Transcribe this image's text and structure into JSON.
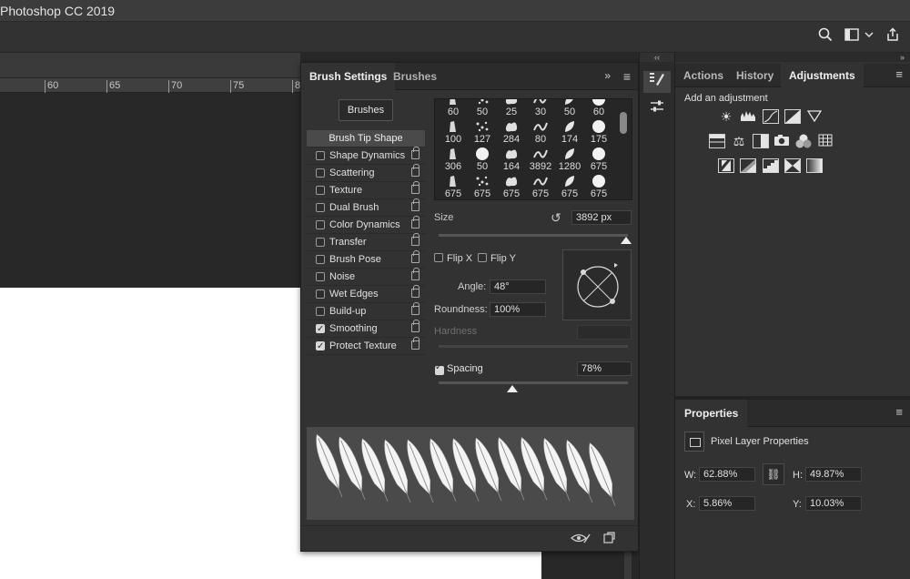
{
  "app": {
    "title": "Photoshop CC 2019"
  },
  "optionsbar": {
    "icons": [
      "search-icon",
      "workspace-icon",
      "share-icon"
    ]
  },
  "ruler": {
    "ticks": [
      "60",
      "65",
      "70",
      "75",
      "8"
    ]
  },
  "brush_panel": {
    "tabs": [
      "Brush Settings",
      "Brushes"
    ],
    "collapse_glyph": "»",
    "brushes_button": "Brushes",
    "options": [
      {
        "label": "Brush Tip Shape",
        "header": true
      },
      {
        "label": "Shape Dynamics",
        "checked": false
      },
      {
        "label": "Scattering",
        "checked": false
      },
      {
        "label": "Texture",
        "checked": false
      },
      {
        "label": "Dual Brush",
        "checked": false
      },
      {
        "label": "Color Dynamics",
        "checked": false
      },
      {
        "label": "Transfer",
        "checked": false
      },
      {
        "label": "Brush Pose",
        "checked": false
      },
      {
        "label": "Noise",
        "checked": false
      },
      {
        "label": "Wet Edges",
        "checked": false
      },
      {
        "label": "Build-up",
        "checked": false
      },
      {
        "label": "Smoothing",
        "checked": true
      },
      {
        "label": "Protect Texture",
        "checked": true
      }
    ],
    "presets": [
      [
        "60",
        "50",
        "25",
        "30",
        "50",
        "60"
      ],
      [
        "100",
        "127",
        "284",
        "80",
        "174",
        "175"
      ],
      [
        "306",
        "50",
        "164",
        "3892",
        "1280",
        "675"
      ],
      [
        "675",
        "675",
        "675",
        "675",
        "675",
        "675"
      ]
    ],
    "size_label": "Size",
    "size_value": "3892 px",
    "flip_x": "Flip X",
    "flip_y": "Flip Y",
    "angle_label": "Angle:",
    "angle_value": "48°",
    "roundness_label": "Roundness:",
    "roundness_value": "100%",
    "hardness_label": "Hardness",
    "spacing_label": "Spacing",
    "spacing_value": "78%",
    "size_level": 0.99,
    "spacing_level": 0.39
  },
  "right_panel": {
    "tabs": [
      "Actions",
      "History",
      "Adjustments"
    ],
    "adjust_hint": "Add an adjustment",
    "properties_tab": "Properties",
    "pixel_layer": "Pixel Layer Properties",
    "w_label": "W:",
    "w_value": "62.88%",
    "h_label": "H:",
    "h_value": "49.87%",
    "x_label": "X:",
    "x_value": "5.86%",
    "y_label": "Y:",
    "y_value": "10.03%"
  }
}
